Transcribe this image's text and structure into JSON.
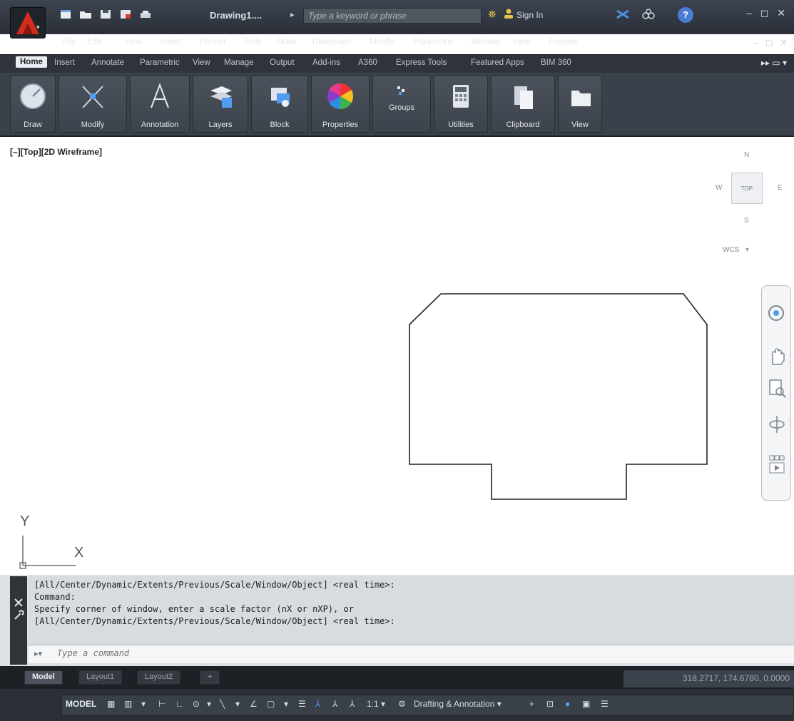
{
  "title_bar": {
    "doc_title": "Drawing1....",
    "doc_arrow": "▸",
    "search_placeholder": "Type a keyword or phrase",
    "binoculars": "⛯",
    "sign_in": "Sign In",
    "help": "?",
    "win_controls": "– ◻ ✕"
  },
  "menu": {
    "items": [
      "File",
      "Edit",
      "View",
      "Insert",
      "Format",
      "Tools",
      "Draw",
      "Dimension",
      "Modify",
      "Parametric",
      "Window",
      "Help",
      "Express"
    ],
    "win_controls": "– ◻ ✕"
  },
  "ribbon_tabs": {
    "items": [
      "Home",
      "Insert",
      "Annotate",
      "Parametric",
      "View",
      "Manage",
      "Output",
      "Add-ins",
      "A360",
      "Express Tools",
      "Featured Apps",
      "BIM 360"
    ],
    "extra": "▸▸ ▭ ▾"
  },
  "ribbon_panels": {
    "items": [
      "Draw",
      "Modify",
      "Annotation",
      "Layers",
      "Block",
      "Properties",
      "Groups",
      "Utilities",
      "Clipboard",
      "View"
    ]
  },
  "viewport": {
    "label": "[–][Top][2D Wireframe]",
    "viewcube": {
      "n": "N",
      "s": "S",
      "e": "E",
      "w": "W",
      "top": "TOP",
      "wcs": "WCS",
      "wcs_arrow": "▾"
    },
    "ucs": {
      "x": "X",
      "y": "Y"
    }
  },
  "command": {
    "history": [
      "[All/Center/Dynamic/Extents/Previous/Scale/Window/Object] <real time>:",
      "Command:",
      "Specify corner of window, enter a scale factor (nX or nXP), or",
      "[All/Center/Dynamic/Extents/Previous/Scale/Window/Object] <real time>:"
    ],
    "input_placeholder": "Type a command",
    "prompt_icon": "▸▾"
  },
  "layout_tabs": {
    "items": [
      "Model",
      "Layout1",
      "Layout2"
    ],
    "add": "+"
  },
  "coords": "318.2717, 174.6780, 0.0000",
  "status": {
    "model": "MODEL",
    "scale": "1:1 ▾",
    "workspace": "Drafting & Annotation ▾"
  },
  "colors": {
    "accent_red": "#d42b1f",
    "ribbon_bg": "#3b414a",
    "title_bg": "#2a2f38",
    "drawing_line": "#222222"
  }
}
